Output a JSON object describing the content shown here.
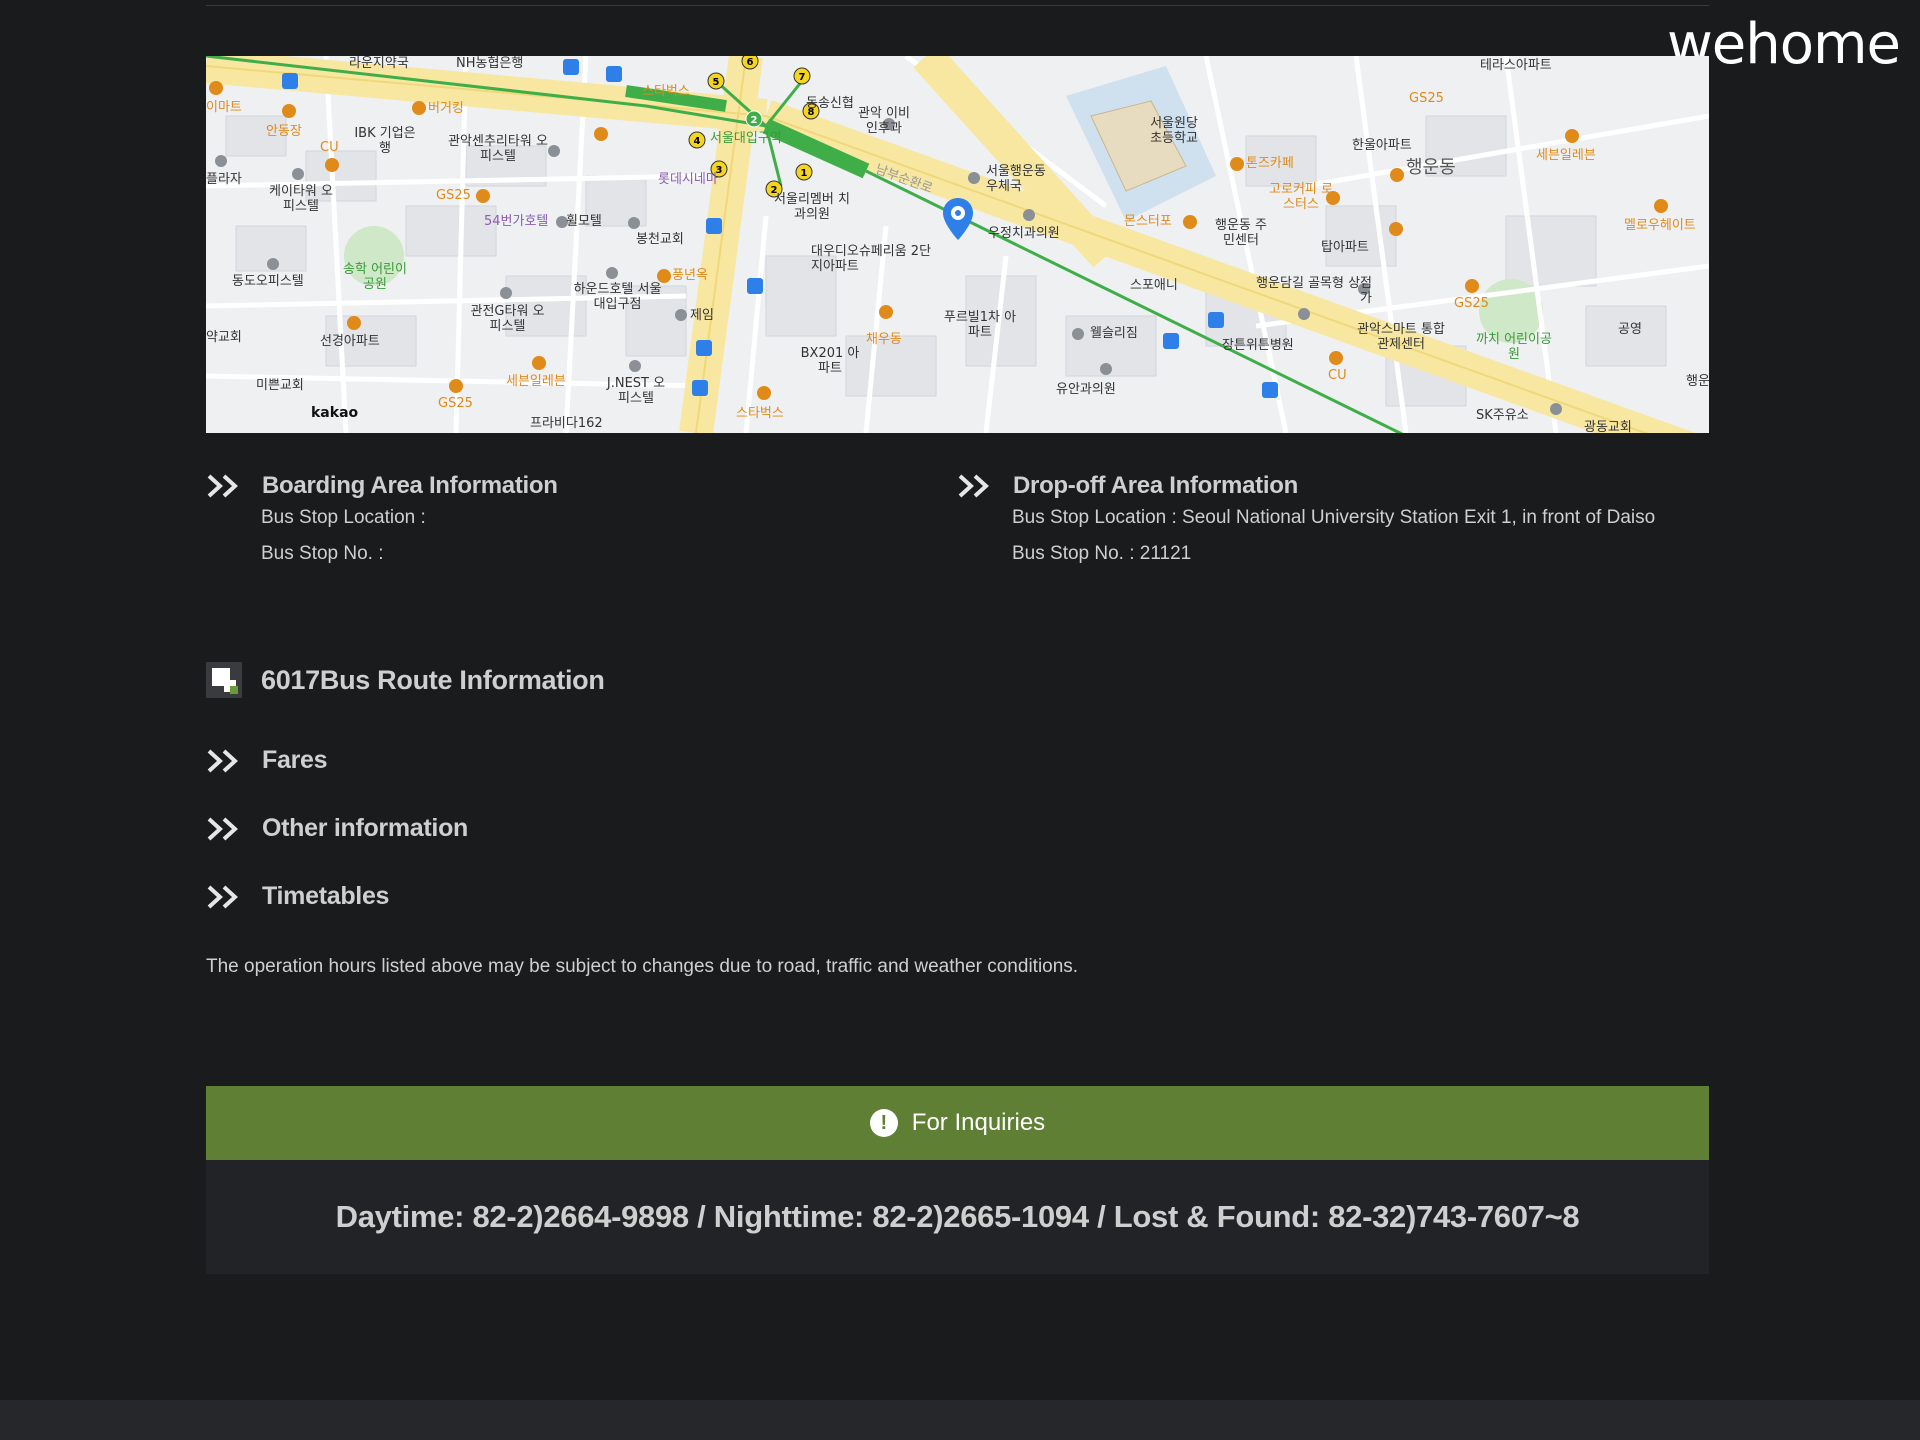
{
  "brand": {
    "name": "wehome"
  },
  "map": {
    "attribution": "kakao",
    "labels": [
      {
        "t": "라운지약국",
        "c": ""
      },
      {
        "t": "NH농협은행",
        "c": ""
      },
      {
        "t": "스타벅스",
        "c": "orange"
      },
      {
        "t": "동송신협",
        "c": ""
      },
      {
        "t": "관악 이비인후과",
        "c": ""
      },
      {
        "t": "서울대입구역",
        "c": "green"
      },
      {
        "t": "롯데시네마",
        "c": "purple"
      },
      {
        "t": "서울리멤버 치과의원",
        "c": ""
      },
      {
        "t": "남부순환로",
        "c": ""
      },
      {
        "t": "서울행운동 우체국",
        "c": ""
      },
      {
        "t": "우정치과의원",
        "c": ""
      },
      {
        "t": "몬스터포",
        "c": "orange"
      },
      {
        "t": "대우디오슈페리움 2단지아파트",
        "c": ""
      },
      {
        "t": "서울원당 초등학교",
        "c": ""
      },
      {
        "t": "톤즈카페",
        "c": "orange"
      },
      {
        "t": "한울아파트",
        "c": ""
      },
      {
        "t": "행운동",
        "c": "big"
      },
      {
        "t": "세븐일레븐",
        "c": "orange"
      },
      {
        "t": "GS25",
        "c": "orange"
      },
      {
        "t": "테라스아파트",
        "c": ""
      },
      {
        "t": "고로커피 로스터스",
        "c": "orange"
      },
      {
        "t": "행운동 주민센터",
        "c": ""
      },
      {
        "t": "탑아파트",
        "c": ""
      },
      {
        "t": "스포애니",
        "c": ""
      },
      {
        "t": "행운담길 골목형 상점가",
        "c": ""
      },
      {
        "t": "관악스마트 통합관제센터",
        "c": ""
      },
      {
        "t": "까치 어린이공원",
        "c": "green"
      },
      {
        "t": "공영",
        "c": ""
      },
      {
        "t": "멜로우헤이트",
        "c": "orange"
      },
      {
        "t": "장튼위튼병원",
        "c": ""
      },
      {
        "t": "웰슬리짐",
        "c": ""
      },
      {
        "t": "유안과의원",
        "c": ""
      },
      {
        "t": "SK주유소",
        "c": ""
      },
      {
        "t": "푸르빌1차 아파트",
        "c": ""
      },
      {
        "t": "채우동",
        "c": "orange"
      },
      {
        "t": "BX201 아파트",
        "c": ""
      },
      {
        "t": "스타벅스",
        "c": "orange"
      },
      {
        "t": "J.NEST 오피스텔",
        "c": ""
      },
      {
        "t": "세븐일레븐",
        "c": "orange"
      },
      {
        "t": "제임",
        "c": ""
      },
      {
        "t": "풍년옥",
        "c": "orange"
      },
      {
        "t": "하운드호텔 서울대입구점",
        "c": ""
      },
      {
        "t": "봉천교회",
        "c": ""
      },
      {
        "t": "휠모텔",
        "c": ""
      },
      {
        "t": "54번가호텔",
        "c": "purple"
      },
      {
        "t": "관전G타워 오피스텔",
        "c": ""
      },
      {
        "t": "선경아파트",
        "c": ""
      },
      {
        "t": "송학 어린이공원",
        "c": "green"
      },
      {
        "t": "동도오피스텔",
        "c": ""
      },
      {
        "t": "케이타워 오피스텔",
        "c": ""
      },
      {
        "t": "GS25",
        "c": "orange"
      },
      {
        "t": "IBK 기업은행",
        "c": ""
      },
      {
        "t": "관악센추리타워 오피스텔",
        "c": ""
      },
      {
        "t": "버거킹",
        "c": "orange"
      },
      {
        "t": "안동장",
        "c": "orange"
      },
      {
        "t": "이마트",
        "c": "orange"
      },
      {
        "t": "플라자",
        "c": ""
      },
      {
        "t": "약교회",
        "c": ""
      },
      {
        "t": "미쁜교회",
        "c": ""
      },
      {
        "t": "프라비다162",
        "c": ""
      },
      {
        "t": "GS25",
        "c": "orange"
      },
      {
        "t": "CU",
        "c": "orange"
      },
      {
        "t": "CU",
        "c": "orange"
      },
      {
        "t": "GS25",
        "c": "orange"
      },
      {
        "t": "광동교회",
        "c": ""
      },
      {
        "t": "행운",
        "c": ""
      }
    ]
  },
  "boarding": {
    "title": "Boarding Area Information",
    "location_label": "Bus Stop Location :",
    "number_label": "Bus Stop No. :"
  },
  "dropoff": {
    "title": "Drop-off Area Information",
    "location_label": "Bus Stop Location : Seoul National University Station Exit 1, in front of Daiso",
    "number_label": "Bus Stop No. : 21121"
  },
  "route": {
    "title": "6017Bus Route Information"
  },
  "sections": [
    {
      "title": "Fares"
    },
    {
      "title": "Other information"
    },
    {
      "title": "Timetables"
    }
  ],
  "note": "The operation hours listed above may be subject to changes due to road, traffic and weather conditions.",
  "inquiries": {
    "icon": "!",
    "label": "For Inquiries",
    "contacts": "Daytime: 82-2)2664-9898 / Nighttime: 82-2)2665-1094 / Lost & Found: 82-32)743-7607~8"
  },
  "colors": {
    "background": "#1a1b1d",
    "accent_green": "#5f7f34",
    "map_road_yellow": "#f7e7a1",
    "route_green": "#3fae49",
    "pin_blue": "#2f7fe8"
  }
}
